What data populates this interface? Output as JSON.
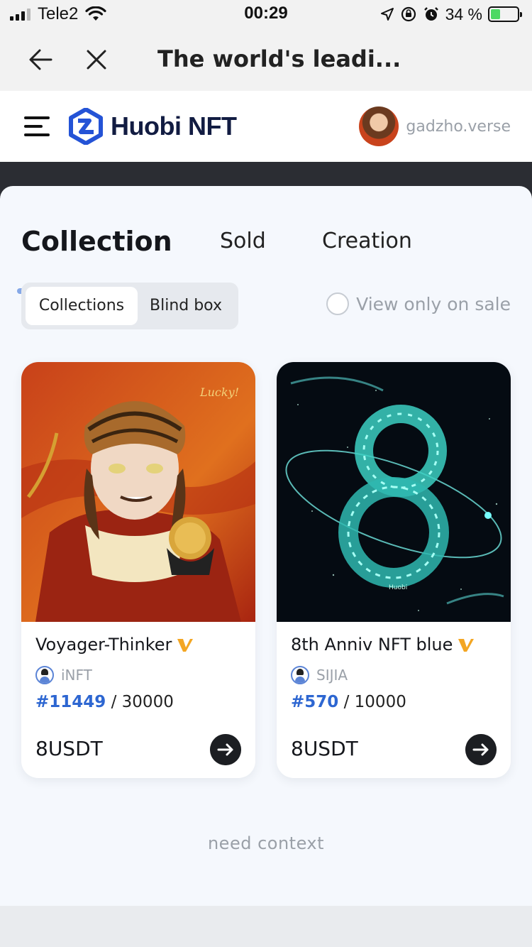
{
  "status_bar": {
    "carrier": "Tele2",
    "time": "00:29",
    "battery_percent": "34 %",
    "battery_level": 0.34,
    "icons": [
      "signal-icon",
      "wifi-icon",
      "location-icon",
      "orientation-lock-icon",
      "alarm-icon",
      "battery-charging-icon"
    ]
  },
  "browser": {
    "title": "The world's leadi..."
  },
  "header": {
    "logo_text": "Huobi NFT",
    "username": "gadzho.verse",
    "brand_color": "#2453d6"
  },
  "tabs": [
    {
      "label": "Collection",
      "active": true
    },
    {
      "label": "Sold",
      "active": false
    },
    {
      "label": "Creation",
      "active": false
    }
  ],
  "filter": {
    "segments": [
      {
        "label": "Collections",
        "active": true
      },
      {
        "label": "Blind box",
        "active": false
      }
    ],
    "sale_toggle_label": "View only on sale",
    "sale_toggle_checked": false
  },
  "cards": [
    {
      "title": "Voyager-Thinker",
      "creator": "iNFT",
      "edition_number": "#11449",
      "edition_total": "/ 30000",
      "price": "8USDT"
    },
    {
      "title": "8th Anniv NFT blue",
      "creator": "SIJIA",
      "edition_number": "#570",
      "edition_total": "/ 10000",
      "price": "8USDT"
    }
  ],
  "footer_note": "need context"
}
